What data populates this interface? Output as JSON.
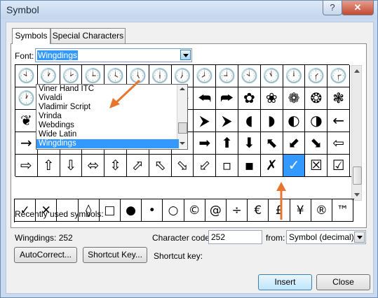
{
  "window": {
    "title": "Symbol",
    "help_label": "?",
    "close_label": "✕"
  },
  "tabs": [
    {
      "label": "Symbols"
    },
    {
      "label": "Special Characters"
    }
  ],
  "font": {
    "label": "Font:",
    "value": "Wingdings"
  },
  "font_dropdown": {
    "items": [
      "Viner Hand ITC",
      "Vivaldi",
      "Vladimir Script",
      "Vrinda",
      "Webdings",
      "Wide Latin",
      "Wingdings"
    ],
    "selected": "Wingdings"
  },
  "symbol_grid": {
    "rows": [
      [
        "🕙",
        "🕐",
        "🕑",
        "🕒",
        "🕓",
        "🕔",
        "🕕",
        "🕖",
        "🕗",
        "🕘",
        "🕙",
        "🕚",
        "🕛",
        "🕜",
        "🕝"
      ],
      [
        "🕐",
        "🕑",
        "🕒",
        "🕓",
        "🕔",
        "🕕",
        "⮨",
        "⮩",
        "⮪",
        "⮫",
        "✿",
        "❀",
        "❁",
        "❂",
        "❃"
      ],
      [
        "❦",
        "🙘",
        "🙙",
        "🙚",
        "🙛",
        "⦾",
        "⦿",
        "⮝",
        "⮞",
        "⮞",
        "◖",
        "◗",
        "◐",
        "◑",
        "←"
      ],
      [
        "→",
        "↑",
        "↓",
        "↖",
        "↗",
        "↙",
        "↘",
        "⬅",
        "➡",
        "⬆",
        "⬇",
        "⬉",
        "⬋",
        "⬊",
        "⇦"
      ],
      [
        "⇨",
        "⇧",
        "⇩",
        "⬄",
        "⇳",
        "⬀",
        "⬁",
        "⬂",
        "⬃",
        "▫",
        "▪",
        "✗",
        "✓",
        "☒",
        "☑"
      ]
    ],
    "selected_symbol": "✓",
    "last_cell_symbol": "⊞"
  },
  "recent": {
    "label": "Recently used symbols:",
    "symbols": [
      "✓",
      "✕",
      "",
      "◊",
      "□",
      "●",
      "•",
      "○",
      "©",
      "@",
      "÷",
      "€",
      "£",
      "¥",
      "®",
      "™"
    ]
  },
  "info": {
    "char_name": "Wingdings: 252",
    "code_label": "Character code:",
    "code_value": "252",
    "from_label": "from:",
    "from_value": "Symbol (decimal)",
    "shortcut_label": "Shortcut key:"
  },
  "buttons": {
    "autocorrect": "AutoCorrect...",
    "shortcut": "Shortcut Key...",
    "insert": "Insert",
    "close": "Close"
  },
  "colors": {
    "selection": "#3399ff",
    "annotation_arrow": "#e8752f"
  }
}
